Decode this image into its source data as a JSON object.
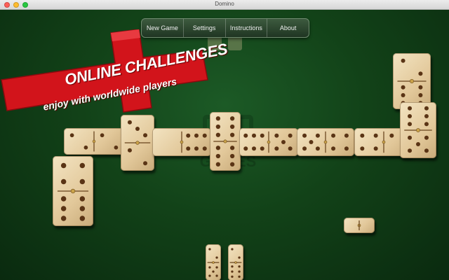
{
  "window": {
    "title": "Domino"
  },
  "menu": {
    "new_game": "New Game",
    "settings": "Settings",
    "instructions": "Instructions",
    "about": "About"
  },
  "promo": {
    "title": "ONLINE CHALLENGES",
    "subtitle": "enjoy with worldwide players",
    "color": "#d2141b"
  },
  "watermark": {
    "text": "GAMES"
  },
  "colors": {
    "table": "#124218",
    "tile": "#ecd8b0",
    "pip": "#5a3415"
  },
  "board": {
    "tiles": [
      {
        "name": "tile-2-2-horizontal",
        "a": 2,
        "b": 2
      },
      {
        "name": "tile-4-6-vertical",
        "a": 4,
        "b": 6
      },
      {
        "name": "tile-3-2-vertical",
        "a": 3,
        "b": 2
      },
      {
        "name": "tile-0-6-horizontal",
        "a": 0,
        "b": 6
      },
      {
        "name": "tile-6-6-vertical",
        "a": 6,
        "b": 6
      },
      {
        "name": "tile-6-5-horizontal",
        "a": 6,
        "b": 5
      },
      {
        "name": "tile-5-4-horizontal",
        "a": 5,
        "b": 4
      },
      {
        "name": "tile-4-2-horizontal",
        "a": 4,
        "b": 2
      },
      {
        "name": "tile-2-6-vertical",
        "a": 2,
        "b": 6
      },
      {
        "name": "tile-6-5-vertical",
        "a": 6,
        "b": 5
      }
    ],
    "boneyard_count": 1
  },
  "hand": [
    {
      "name": "hand-tile-1",
      "a": 2,
      "b": 5
    },
    {
      "name": "hand-tile-2",
      "a": 2,
      "b": 6
    }
  ]
}
